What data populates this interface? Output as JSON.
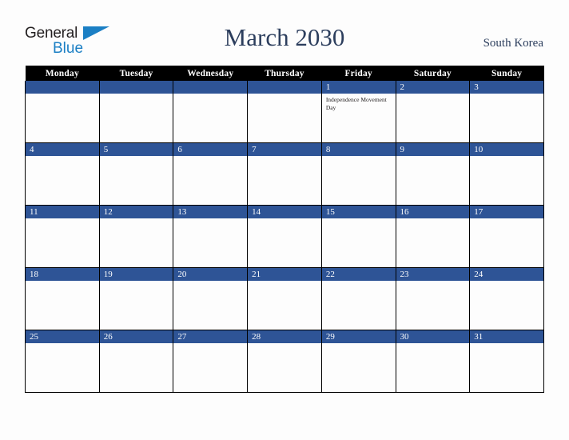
{
  "brand": {
    "name_top": "General",
    "name_bottom": "Blue",
    "triangle_icon": "triangle-icon",
    "color_dark": "#231f20",
    "color_blue": "#1b7fc4"
  },
  "header": {
    "title": "March 2030",
    "country": "South Korea",
    "title_color": "#2c3e5d"
  },
  "calendar": {
    "weekday_headers": [
      "Monday",
      "Tuesday",
      "Wednesday",
      "Thursday",
      "Friday",
      "Saturday",
      "Sunday"
    ],
    "header_bg": "#000000",
    "header_text": "#ffffff",
    "date_band_bg": "#2e5496",
    "date_text": "#ffffff",
    "cell_bg": "#fdfdfd",
    "grid_line": "#000000",
    "weeks": [
      {
        "days": [
          {
            "num": "",
            "holiday": ""
          },
          {
            "num": "",
            "holiday": ""
          },
          {
            "num": "",
            "holiday": ""
          },
          {
            "num": "",
            "holiday": ""
          },
          {
            "num": "1",
            "holiday": "Independence Movement Day"
          },
          {
            "num": "2",
            "holiday": ""
          },
          {
            "num": "3",
            "holiday": ""
          }
        ]
      },
      {
        "days": [
          {
            "num": "4",
            "holiday": ""
          },
          {
            "num": "5",
            "holiday": ""
          },
          {
            "num": "6",
            "holiday": ""
          },
          {
            "num": "7",
            "holiday": ""
          },
          {
            "num": "8",
            "holiday": ""
          },
          {
            "num": "9",
            "holiday": ""
          },
          {
            "num": "10",
            "holiday": ""
          }
        ]
      },
      {
        "days": [
          {
            "num": "11",
            "holiday": ""
          },
          {
            "num": "12",
            "holiday": ""
          },
          {
            "num": "13",
            "holiday": ""
          },
          {
            "num": "14",
            "holiday": ""
          },
          {
            "num": "15",
            "holiday": ""
          },
          {
            "num": "16",
            "holiday": ""
          },
          {
            "num": "17",
            "holiday": ""
          }
        ]
      },
      {
        "days": [
          {
            "num": "18",
            "holiday": ""
          },
          {
            "num": "19",
            "holiday": ""
          },
          {
            "num": "20",
            "holiday": ""
          },
          {
            "num": "21",
            "holiday": ""
          },
          {
            "num": "22",
            "holiday": ""
          },
          {
            "num": "23",
            "holiday": ""
          },
          {
            "num": "24",
            "holiday": ""
          }
        ]
      },
      {
        "days": [
          {
            "num": "25",
            "holiday": ""
          },
          {
            "num": "26",
            "holiday": ""
          },
          {
            "num": "27",
            "holiday": ""
          },
          {
            "num": "28",
            "holiday": ""
          },
          {
            "num": "29",
            "holiday": ""
          },
          {
            "num": "30",
            "holiday": ""
          },
          {
            "num": "31",
            "holiday": ""
          }
        ]
      }
    ]
  }
}
